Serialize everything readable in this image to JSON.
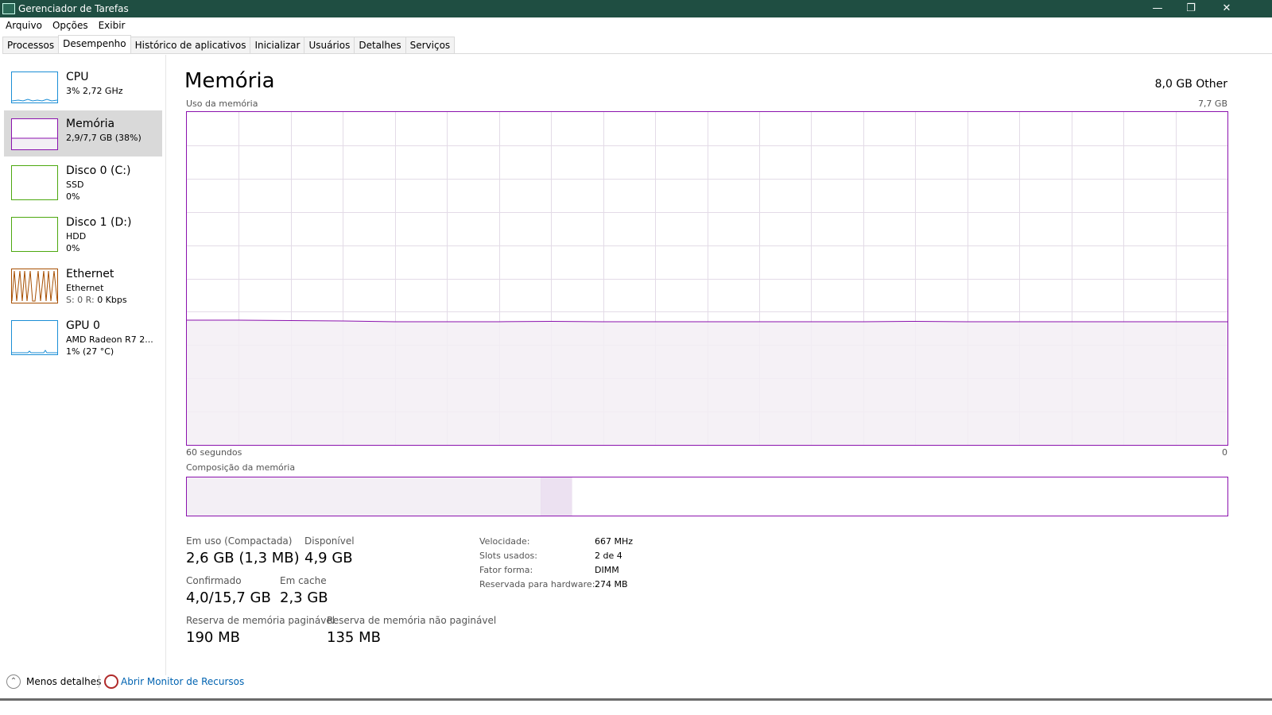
{
  "window": {
    "title": "Gerenciador de Tarefas"
  },
  "menu": [
    "Arquivo",
    "Opções",
    "Exibir"
  ],
  "tabs": [
    "Processos",
    "Desempenho",
    "Histórico de aplicativos",
    "Inicializar",
    "Usuários",
    "Detalhes",
    "Serviços"
  ],
  "sidebar": [
    {
      "name": "CPU",
      "line1": "3%  2,72 GHz",
      "line2": "",
      "color": "#1b8ed6",
      "selected": false
    },
    {
      "name": "Memória",
      "line1": "2,9/7,7 GB (38%)",
      "line2": "",
      "color": "#8b12ae",
      "selected": true
    },
    {
      "name": "Disco 0 (C:)",
      "line1": "SSD",
      "line2": "0%",
      "color": "#4ca80f",
      "selected": false
    },
    {
      "name": "Disco 1 (D:)",
      "line1": "HDD",
      "line2": "0%",
      "color": "#4ca80f",
      "selected": false
    },
    {
      "name": "Ethernet",
      "line1": "Ethernet",
      "line2_prefix": "S: 0 R: ",
      "line2_suffix": "0 Kbps",
      "color": "#a74f01",
      "selected": false
    },
    {
      "name": "GPU 0",
      "line1": "AMD Radeon R7 2...",
      "line2": "1% (27 °C)",
      "color": "#1b8ed6",
      "selected": false
    }
  ],
  "main": {
    "title": "Memória",
    "total": "8,0 GB Other",
    "graph_label": "Uso da memória",
    "graph_max": "7,7 GB",
    "time_left": "60 segundos",
    "time_right": "0",
    "composition_label": "Composição da memória",
    "usage_fraction": 0.37,
    "composition": {
      "in_use": 0.34,
      "modified": 0.03,
      "standby": 0.26,
      "free": 0.37
    },
    "colors": {
      "accent": "#8b12ae",
      "fill": "#f3eff5"
    }
  },
  "stats": {
    "in_use_label": "Em uso (Compactada)",
    "in_use_value": "2,6 GB (1,3 MB)",
    "available_label": "Disponível",
    "available_value": "4,9 GB",
    "committed_label": "Confirmado",
    "committed_value": "4,0/15,7 GB",
    "cached_label": "Em cache",
    "cached_value": "2,3 GB",
    "paged_label": "Reserva de memória paginável",
    "paged_value": "190 MB",
    "nonpaged_label": "Reserva de memória não paginável",
    "nonpaged_value": "135 MB"
  },
  "specs": [
    {
      "label": "Velocidade:",
      "value": "667 MHz"
    },
    {
      "label": "Slots usados:",
      "value": "2 de 4"
    },
    {
      "label": "Fator forma:",
      "value": "DIMM"
    },
    {
      "label": "Reservada para hardware:",
      "value": "274 MB"
    }
  ],
  "footer": {
    "fewer_details": "Menos detalhes",
    "resource_monitor": "Abrir Monitor de Recursos"
  }
}
